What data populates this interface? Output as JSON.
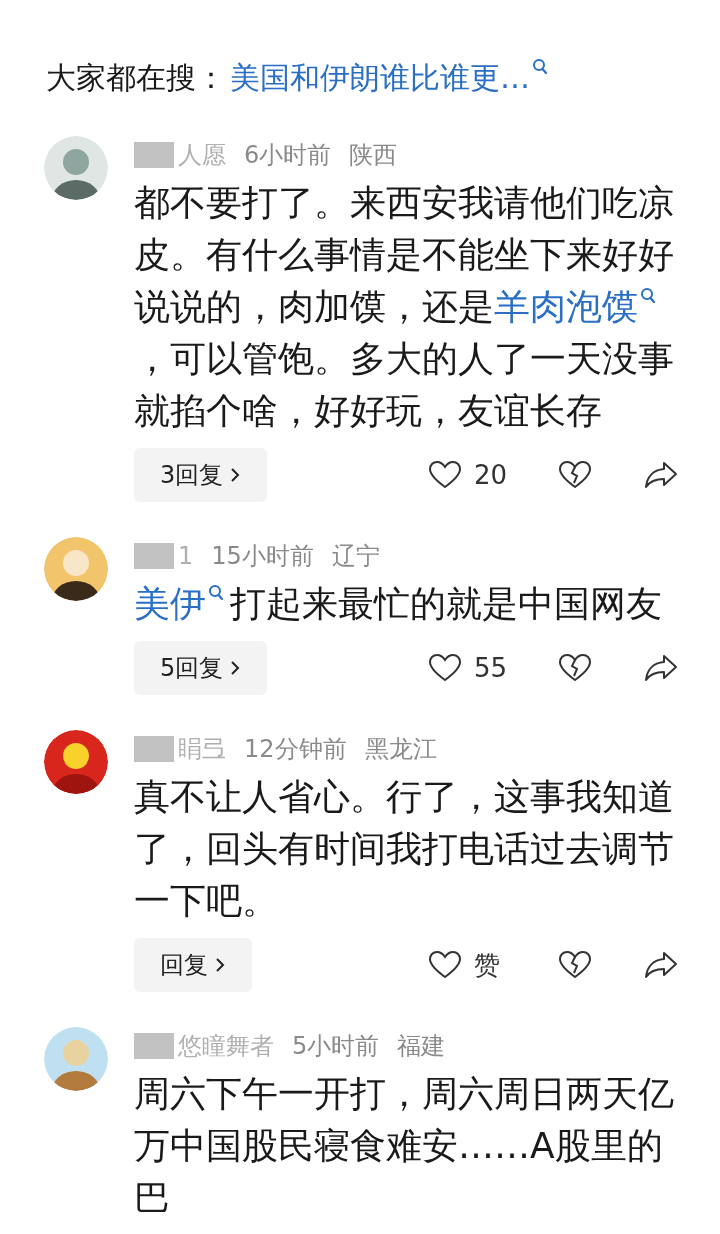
{
  "trending_search": {
    "label": "大家都在搜：",
    "query": "美国和伊朗谁比谁更…"
  },
  "comments": [
    {
      "user": "人愿",
      "time": "6小时前",
      "region": "陕西",
      "content": [
        {
          "kind": "text",
          "text": "都不要打了。来西安我请他们吃凉皮。有什么事情是不能坐下来好好说说的，肉加馍，还是"
        },
        {
          "kind": "link",
          "text": "羊肉泡馍"
        },
        {
          "kind": "text",
          "text": "，可以管饱。多大的人了一天没事就掐个啥，好好玩，友谊长存"
        }
      ],
      "replies": "3回复",
      "likes": "20"
    },
    {
      "user": "1",
      "time": "15小时前",
      "region": "辽宁",
      "content": [
        {
          "kind": "link",
          "text": "美伊"
        },
        {
          "kind": "text",
          "text": "打起来最忙的就是中国网友"
        }
      ],
      "replies": "5回复",
      "likes": "55"
    },
    {
      "user": "睊弖",
      "time": "12分钟前",
      "region": "黑龙江",
      "content": [
        {
          "kind": "text",
          "text": "真不让人省心。行了，这事我知道了，回头有时间我打电话过去调节一下吧。"
        }
      ],
      "replies": "回复",
      "likes": "赞"
    },
    {
      "user": "悠瞳舞者",
      "time": "5小时前",
      "region": "福建",
      "content": [
        {
          "kind": "text",
          "text": "周六下午一开打，周六周日两天亿万中国股民寝食难安……A股里的巴"
        }
      ]
    }
  ]
}
